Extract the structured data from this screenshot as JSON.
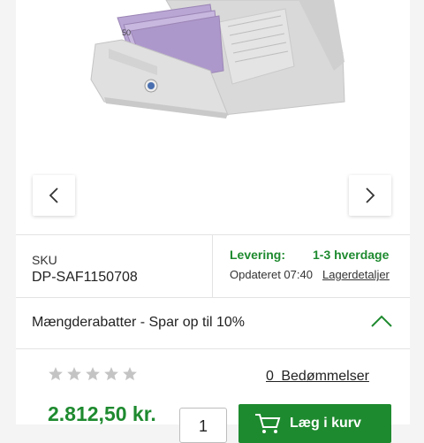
{
  "image": {
    "alt": "Banknote counting machine"
  },
  "navigation": {
    "prev_icon": "chevron-left-icon",
    "next_icon": "chevron-right-icon"
  },
  "info": {
    "sku_label": "SKU",
    "sku_value": "DP-SAF1150708",
    "delivery_label": "Levering:",
    "delivery_value": "1-3 hverdage",
    "updated_text": "Opdateret 07:40",
    "stock_link": "Lagerdetaljer"
  },
  "discount": {
    "label": "Mængderabatter - Spar op til 10%",
    "icon": "chevron-up-icon"
  },
  "rating": {
    "stars_filled": 0,
    "stars_total": 5,
    "reviews_label": "0 Bedømmelser"
  },
  "purchase": {
    "price": "2.812,50 kr.",
    "quantity": "1",
    "cart_label": "Læg i kurv"
  },
  "colors": {
    "accent": "#1e8a2f",
    "star_empty": "#c4c4c4",
    "background": "#f4f4f4"
  }
}
